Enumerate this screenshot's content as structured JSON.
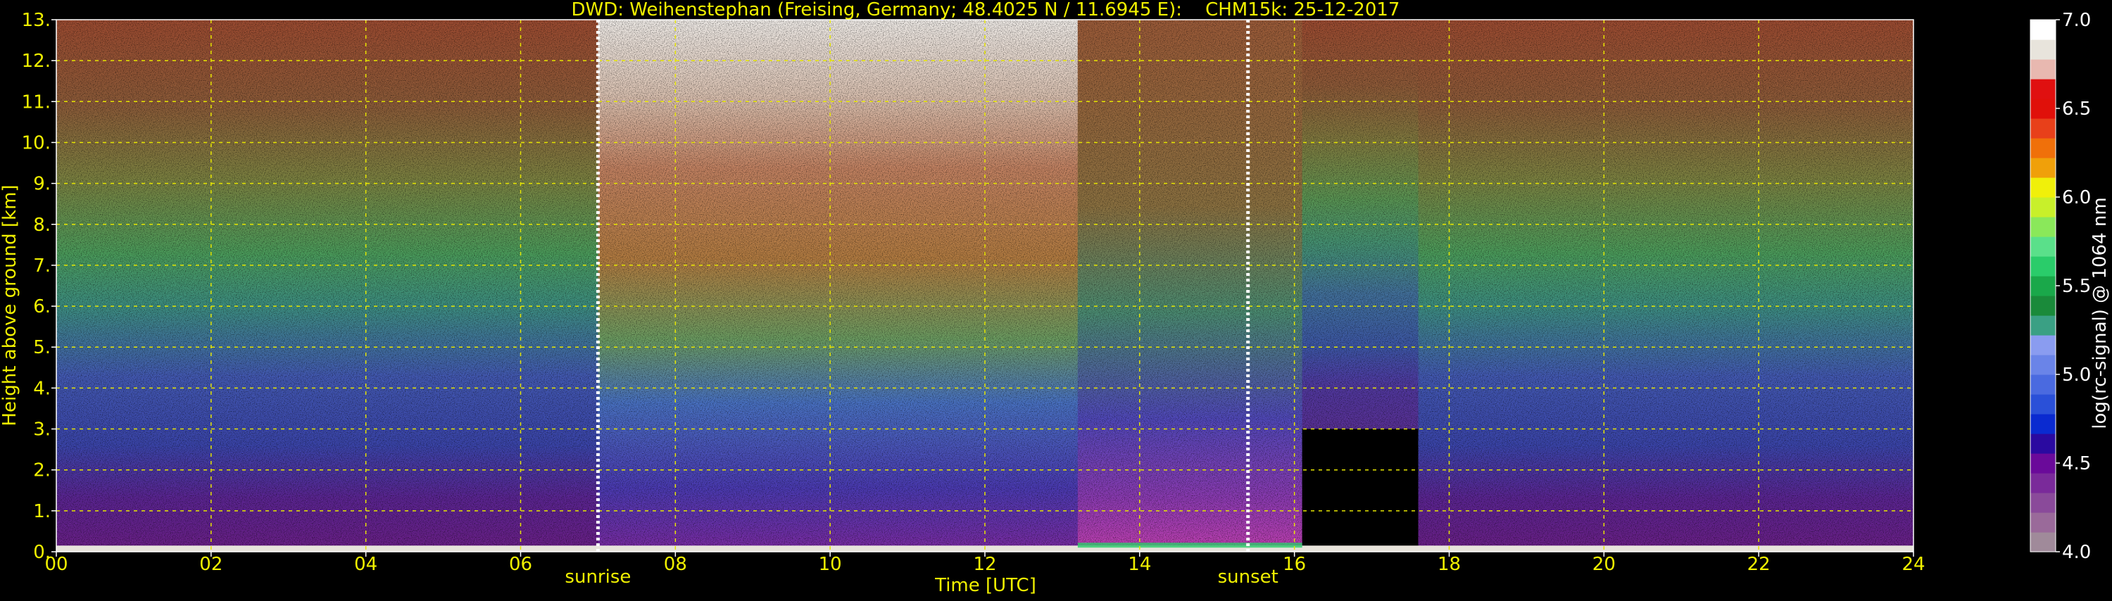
{
  "chart_data": {
    "type": "heatmap",
    "title": "DWD: Weihenstephan (Freising, Germany; 48.4025 N / 11.6945 E):    CHM15k: 25-12-2017",
    "xlabel": "Time [UTC]",
    "ylabel": "Height above ground [km]",
    "xlim": [
      0,
      24
    ],
    "ylim": [
      0,
      13
    ],
    "x_ticks": [
      0,
      2,
      4,
      6,
      8,
      10,
      12,
      14,
      16,
      18,
      20,
      22,
      24
    ],
    "x_tick_labels": [
      "00",
      "02",
      "04",
      "06",
      "08",
      "10",
      "12",
      "14",
      "16",
      "18",
      "20",
      "22",
      "24"
    ],
    "y_ticks": [
      0,
      1,
      2,
      3,
      4,
      5,
      6,
      7,
      8,
      9,
      10,
      11,
      12,
      13
    ],
    "y_tick_labels": [
      "0.",
      "1.",
      "2.",
      "3.",
      "4.",
      "5.",
      "6.",
      "7.",
      "8.",
      "9.",
      "10.",
      "11.",
      "12.",
      "13."
    ],
    "grid": true,
    "markers": [
      {
        "label": "sunrise",
        "x": 7.0
      },
      {
        "label": "sunset",
        "x": 15.4
      }
    ],
    "colorbar": {
      "label": "log(rc-signal) @ 1064 nm",
      "range": [
        4.0,
        7.0
      ],
      "ticks": [
        4.0,
        4.5,
        5.0,
        5.5,
        6.0,
        6.5,
        7.0
      ],
      "tick_labels": [
        "4.0",
        "4.5",
        "5.0",
        "5.5",
        "6.0",
        "6.5",
        "7.0"
      ],
      "colors": [
        "#a08a9a",
        "#9a6a9a",
        "#8a4a9a",
        "#7a2a9a",
        "#6a0a9a",
        "#2a0aa0",
        "#0a2ad0",
        "#2a50d8",
        "#4a6ae0",
        "#6a84e8",
        "#8a9cf0",
        "#3aa084",
        "#1a8a3a",
        "#1aa84a",
        "#2acc6a",
        "#5ae08a",
        "#8ae85a",
        "#c8f02a",
        "#f0f00a",
        "#f0a00a",
        "#f0700a",
        "#e8401a",
        "#e0100a",
        "#e01010",
        "#e8b8b0",
        "#e8e4dc",
        "#ffffff"
      ]
    }
  }
}
